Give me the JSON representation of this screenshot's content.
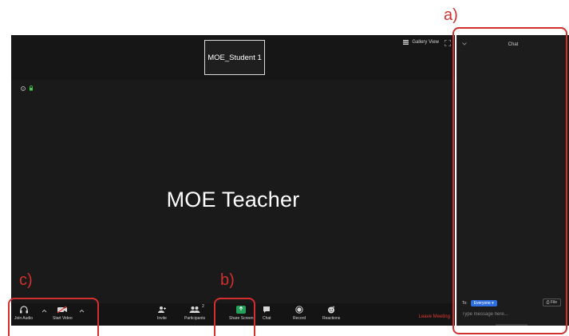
{
  "meeting": {
    "participant_thumbnail": "MOE_Student 1",
    "gallery_view_label": "Gallery View",
    "speaker_name": "MOE Teacher"
  },
  "toolbar": {
    "join_audio": "Join Audio",
    "start_video": "Start Video",
    "invite": "Invite",
    "participants": "Participants",
    "participants_count": "2",
    "share_screen": "Share Screen",
    "chat": "Chat",
    "record": "Record",
    "reactions": "Reactions",
    "leave_meeting": "Leave Meeting"
  },
  "chat_panel": {
    "title": "Chat",
    "to_label": "To:",
    "recipient": "Everyone",
    "file_label": "File",
    "message_placeholder": "Type message here..."
  },
  "annotations": {
    "a": "a)",
    "b": "b)",
    "c": "c)"
  },
  "colors": {
    "annotation": "#d32f2f",
    "share_screen": "#23a05a",
    "leave": "#e53935",
    "recipient_badge": "#2d6fe0"
  }
}
